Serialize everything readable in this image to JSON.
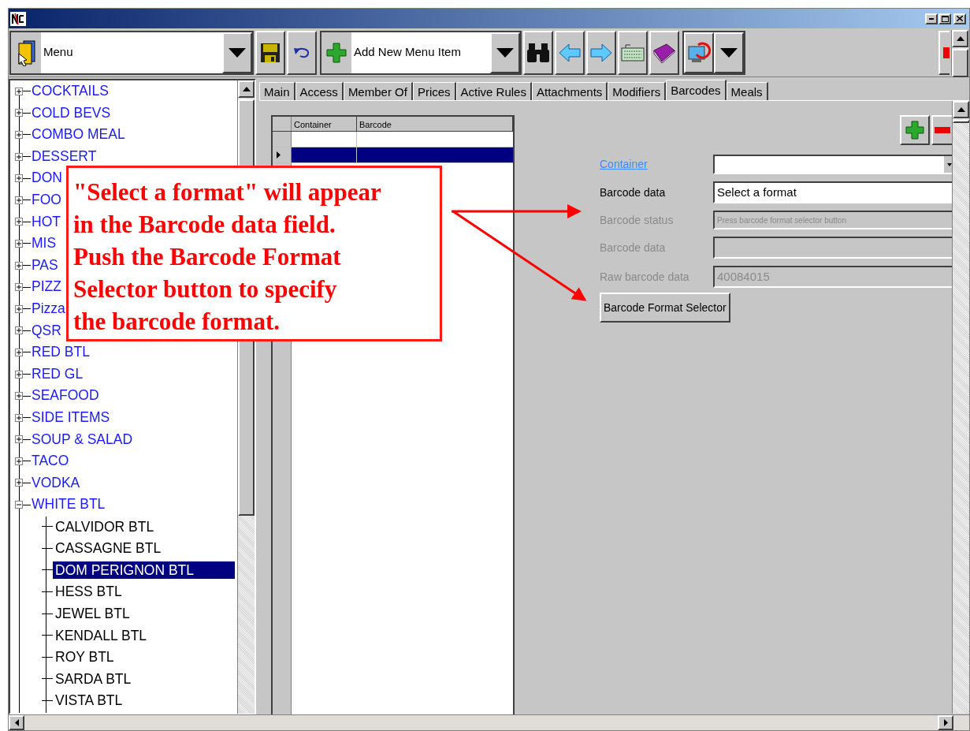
{
  "toolbar": {
    "menu_combo": {
      "value": "Menu"
    },
    "add_combo": {
      "value": "Add New Menu Item"
    }
  },
  "tree": [
    {
      "label": "COCKTAILS",
      "expanded": false,
      "selected": false
    },
    {
      "label": "COLD BEVS",
      "expanded": false,
      "selected": false
    },
    {
      "label": "COMBO MEAL",
      "expanded": false,
      "selected": false
    },
    {
      "label": "DESSERT",
      "expanded": false,
      "selected": false
    },
    {
      "label": "DON",
      "expanded": false,
      "selected": false
    },
    {
      "label": "FOO",
      "expanded": false,
      "selected": false
    },
    {
      "label": "HOT",
      "expanded": false,
      "selected": false
    },
    {
      "label": "MIS",
      "expanded": false,
      "selected": false
    },
    {
      "label": "PAS",
      "expanded": false,
      "selected": false
    },
    {
      "label": "PIZZ",
      "expanded": false,
      "selected": false
    },
    {
      "label": "Pizza",
      "expanded": false,
      "selected": false
    },
    {
      "label": "QSR",
      "expanded": false,
      "selected": false
    },
    {
      "label": "RED BTL",
      "expanded": false,
      "selected": false
    },
    {
      "label": "RED GL",
      "expanded": false,
      "selected": false
    },
    {
      "label": "SEAFOOD",
      "expanded": false,
      "selected": false
    },
    {
      "label": "SIDE ITEMS",
      "expanded": false,
      "selected": false
    },
    {
      "label": "SOUP & SALAD",
      "expanded": false,
      "selected": false
    },
    {
      "label": "TACO",
      "expanded": false,
      "selected": false
    },
    {
      "label": "VODKA",
      "expanded": false,
      "selected": false
    },
    {
      "label": "WHITE BTL",
      "expanded": true,
      "selected": false,
      "children": [
        {
          "label": "CALVIDOR BTL",
          "selected": false
        },
        {
          "label": "CASSAGNE BTL",
          "selected": false
        },
        {
          "label": "DOM PERIGNON BTL",
          "selected": true
        },
        {
          "label": "HESS BTL",
          "selected": false
        },
        {
          "label": "JEWEL BTL",
          "selected": false
        },
        {
          "label": "KENDALL BTL",
          "selected": false
        },
        {
          "label": "ROY BTL",
          "selected": false
        },
        {
          "label": "SARDA BTL",
          "selected": false
        },
        {
          "label": "VISTA BTL",
          "selected": false
        }
      ]
    }
  ],
  "tabs": [
    {
      "label": "Main",
      "selected": false
    },
    {
      "label": "Access",
      "selected": false
    },
    {
      "label": "Member Of",
      "selected": false
    },
    {
      "label": "Prices",
      "selected": false
    },
    {
      "label": "Active Rules",
      "selected": false
    },
    {
      "label": "Attachments",
      "selected": false
    },
    {
      "label": "Modifiers",
      "selected": false
    },
    {
      "label": "Barcodes",
      "selected": true
    },
    {
      "label": "Meals",
      "selected": false
    }
  ],
  "grid": {
    "columns": [
      "Container",
      "Barcode"
    ],
    "rows": [
      {
        "selected": false
      },
      {
        "selected": true
      }
    ]
  },
  "form": [
    {
      "label": "Container",
      "kind": "dropdown",
      "disabled": false
    },
    {
      "label": "Barcode data",
      "kind": "text",
      "value": "Select a format",
      "disabled": false
    },
    {
      "label": "Barcode status",
      "kind": "status",
      "value": "Press barcode format selector button",
      "disabled": true
    },
    {
      "label": "Barcode data",
      "kind": "text",
      "disabled": true
    },
    {
      "label": "Raw barcode data",
      "kind": "text",
      "value": "40084015",
      "disabled": true
    }
  ],
  "selector_button": "Barcode Format Selector",
  "callout": {
    "lines": [
      "\"Select a format\" will appear",
      "in the Barcode data field.",
      "Push the Barcode Format",
      "Selector button to specify",
      "the barcode format."
    ]
  }
}
